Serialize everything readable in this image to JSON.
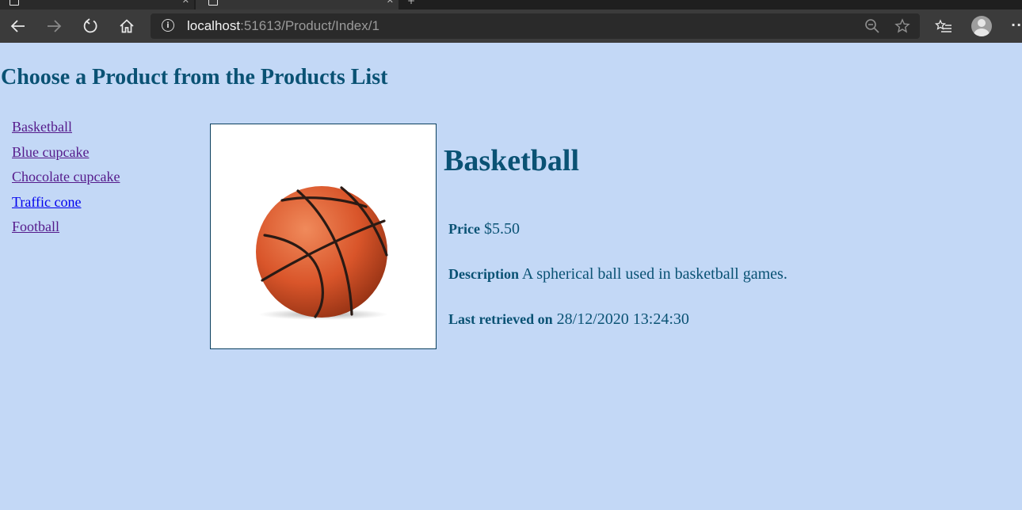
{
  "browser": {
    "url_host": "localhost",
    "url_path": ":51613/Product/Index/1"
  },
  "page": {
    "title": "Choose a Product from the Products List"
  },
  "products": [
    {
      "label": "Basketball"
    },
    {
      "label": "Blue cupcake"
    },
    {
      "label": "Chocolate cupcake"
    },
    {
      "label": "Traffic cone"
    },
    {
      "label": "Football"
    }
  ],
  "detail": {
    "name": "Basketball",
    "price_label": "Price",
    "price_value": "$5.50",
    "description_label": "Description",
    "description_value": "A spherical ball used in basketball games.",
    "retrieved_label": "Last retrieved on",
    "retrieved_value": "28/12/2020 13:24:30"
  },
  "colors": {
    "page_background": "#c3d8f6",
    "heading": "#0a5274",
    "visited_link": "#551a8b",
    "unvisited_link": "#0000ee",
    "ball": "#d9552a"
  }
}
